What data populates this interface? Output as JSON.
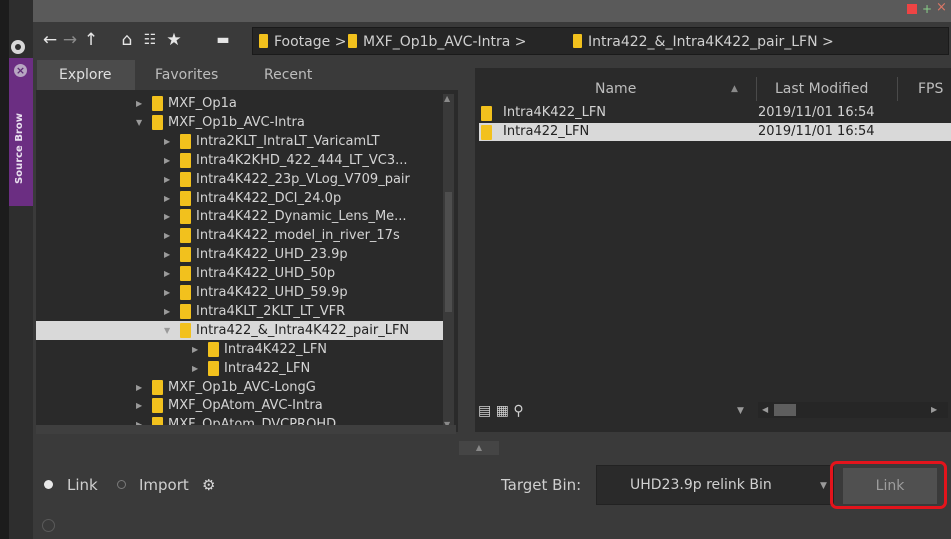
{
  "window": {
    "min_icon": "minimize-icon",
    "max_icon": "maximize-icon",
    "close_icon": "close-icon"
  },
  "side_tab": {
    "label": "Source Brow"
  },
  "nav": {
    "breadcrumbs": [
      {
        "label": "Footage"
      },
      {
        "label": "MXF_Op1b_AVC-Intra"
      },
      {
        "label": "Intra422_&_Intra4K422_pair_LFN"
      }
    ],
    "separator": ">"
  },
  "tabs": [
    {
      "label": "Explore"
    },
    {
      "label": "Favorites"
    },
    {
      "label": "Recent"
    }
  ],
  "tree": [
    {
      "label": "MXF_Op1a",
      "expanded": false
    },
    {
      "label": "MXF_Op1b_AVC-Intra",
      "expanded": true
    },
    {
      "label": "Intra2KLT_IntraLT_VaricamLT",
      "expanded": false
    },
    {
      "label": "Intra4K2KHD_422_444_LT_VC3...",
      "expanded": false
    },
    {
      "label": "Intra4K422_23p_VLog_V709_pair",
      "expanded": false
    },
    {
      "label": "Intra4K422_DCI_24.0p",
      "expanded": false
    },
    {
      "label": "Intra4K422_Dynamic_Lens_Me...",
      "expanded": false
    },
    {
      "label": "Intra4K422_model_in_river_17s",
      "expanded": false
    },
    {
      "label": "Intra4K422_UHD_23.9p",
      "expanded": false
    },
    {
      "label": "Intra4K422_UHD_50p",
      "expanded": false
    },
    {
      "label": "Intra4K422_UHD_59.9p",
      "expanded": false
    },
    {
      "label": "Intra4KLT_2KLT_LT_VFR",
      "expanded": false
    },
    {
      "label": "Intra422_&_Intra4K422_pair_LFN",
      "expanded": true,
      "selected": true
    },
    {
      "label": "Intra4K422_LFN",
      "expanded": false
    },
    {
      "label": "Intra422_LFN",
      "expanded": false
    },
    {
      "label": "MXF_Op1b_AVC-LongG",
      "expanded": false
    },
    {
      "label": "MXF_OpAtom_AVC-Intra",
      "expanded": false
    },
    {
      "label": "MXF_OpAtom_DVCPROHD",
      "expanded": false
    }
  ],
  "files": {
    "columns": [
      {
        "label": "Name"
      },
      {
        "label": "Last Modified"
      },
      {
        "label": "FPS"
      }
    ],
    "sort_indicator": "▲",
    "rows": [
      {
        "name": "Intra4K422_LFN",
        "modified": "2019/11/01 16:54",
        "selected": false
      },
      {
        "name": "Intra422_LFN",
        "modified": "2019/11/01 16:54",
        "selected": true
      }
    ]
  },
  "bottom": {
    "link_option": "Link",
    "import_option": "Import",
    "target_bin_label": "Target Bin:",
    "target_bin_value": "UHD23.9p relink Bin",
    "link_button": "Link"
  },
  "colors": {
    "folder": "#f2c11d",
    "accent_purple": "#6b2e82",
    "highlight_red": "#e3141c"
  }
}
